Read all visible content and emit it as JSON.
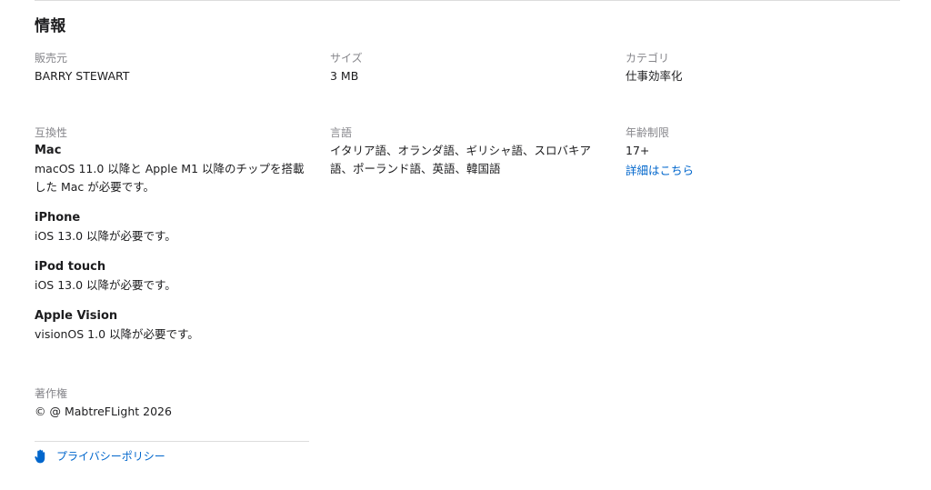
{
  "section": {
    "title": "情報"
  },
  "seller": {
    "label": "販売元",
    "value": "BARRY STEWART"
  },
  "size": {
    "label": "サイズ",
    "value": "3 MB"
  },
  "category": {
    "label": "カテゴリ",
    "value": "仕事効率化"
  },
  "compatibility": {
    "label": "互換性",
    "devices": [
      {
        "name": "Mac",
        "requirement": "macOS 11.0 以降と Apple M1 以降のチップを搭載した Mac が必要です。"
      },
      {
        "name": "iPhone",
        "requirement": "iOS 13.0 以降が必要です。"
      },
      {
        "name": "iPod touch",
        "requirement": "iOS 13.0 以降が必要です。"
      },
      {
        "name": "Apple Vision",
        "requirement": "visionOS 1.0 以降が必要です。"
      }
    ]
  },
  "languages": {
    "label": "言語",
    "value": "イタリア語、オランダ語、ギリシャ語、スロバキア語、ポーランド語、英語、韓国語"
  },
  "age_rating": {
    "label": "年齢制限",
    "value": "17+",
    "link": "詳細はこちら"
  },
  "copyright": {
    "label": "著作権",
    "value": "© @ MabtreFLight 2026"
  },
  "privacy": {
    "icon": "hand-icon",
    "link": "プライバシーポリシー"
  },
  "colors": {
    "link": "#0066cc",
    "label": "#86868b",
    "text": "#1d1d1f"
  }
}
